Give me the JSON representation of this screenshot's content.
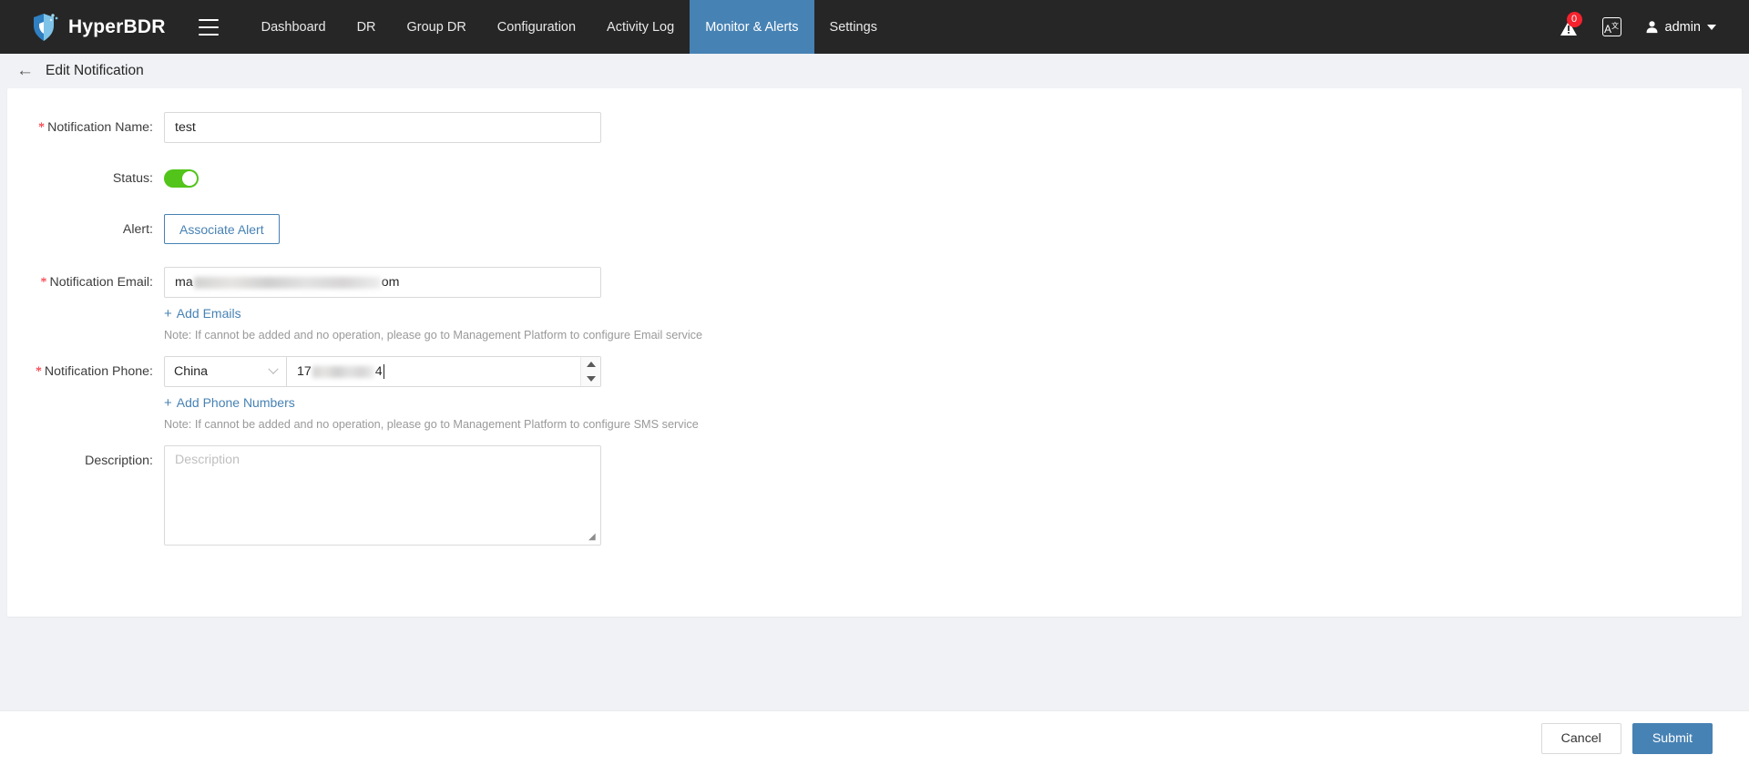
{
  "navbar": {
    "brand": "HyperBDR",
    "menu_icon": "hamburger-icon",
    "items": [
      {
        "label": "Dashboard",
        "active": false
      },
      {
        "label": "DR",
        "active": false
      },
      {
        "label": "Group DR",
        "active": false
      },
      {
        "label": "Configuration",
        "active": false
      },
      {
        "label": "Activity Log",
        "active": false
      },
      {
        "label": "Monitor & Alerts",
        "active": true
      },
      {
        "label": "Settings",
        "active": false
      }
    ],
    "alarm_badge": "0",
    "language_icon": "A文",
    "user": "admin",
    "active_color": "#4782b4",
    "background": "#262626"
  },
  "page": {
    "back_label": "←",
    "title": "Edit Notification"
  },
  "form": {
    "notification_name": {
      "label": "Notification Name:",
      "required": true,
      "value": "test"
    },
    "status": {
      "label": "Status:",
      "required": false,
      "enabled": true,
      "on_color": "#52c41a"
    },
    "alert": {
      "label": "Alert:",
      "required": false,
      "button_label": "Associate Alert"
    },
    "notification_email": {
      "label": "Notification Email:",
      "required": true,
      "value_prefix": "ma",
      "value_masked": true,
      "value_suffix": "om",
      "add_link": "Add Emails",
      "note": "Note: If cannot be added and no operation, please go to Management Platform to configure Email service"
    },
    "notification_phone": {
      "label": "Notification Phone:",
      "required": true,
      "country": "China",
      "value_prefix": "17",
      "value_masked": true,
      "value_suffix": "4",
      "add_link": "Add Phone Numbers",
      "note": "Note: If cannot be added and no operation, please go to Management Platform to configure SMS service"
    },
    "description": {
      "label": "Description:",
      "required": false,
      "value": "",
      "placeholder": "Description"
    }
  },
  "footer": {
    "cancel_label": "Cancel",
    "submit_label": "Submit",
    "submit_color": "#4782b4"
  }
}
